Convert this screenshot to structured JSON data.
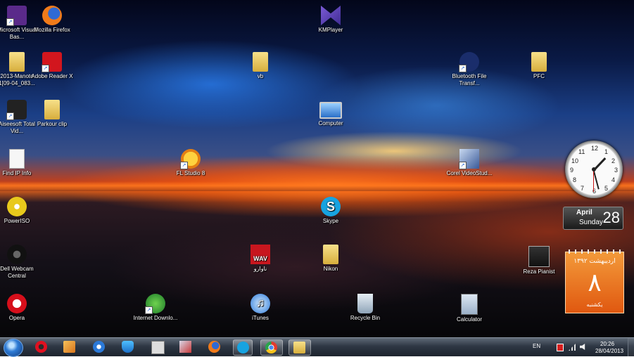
{
  "desktop_icons": [
    {
      "name": "Microsoft Visual Bas...",
      "key": "vb"
    },
    {
      "name": "Mozilla Firefox",
      "key": "firefox"
    },
    {
      "name": "2013-Manoto 1[09-04_083...",
      "key": "folder"
    },
    {
      "name": "Adobe Reader X",
      "key": "pdf"
    },
    {
      "name": "Aiseesoft Total Vid...",
      "key": "aise"
    },
    {
      "name": "Parkour clip",
      "key": "folder"
    },
    {
      "name": "Find IP Info",
      "key": "doc"
    },
    {
      "name": "PowerISO",
      "key": "disc"
    },
    {
      "name": "Dell Webcam Central",
      "key": "webcam"
    },
    {
      "name": "Opera",
      "key": "opera"
    },
    {
      "name": "KMPlayer",
      "key": "km"
    },
    {
      "name": "vb",
      "key": "folder"
    },
    {
      "name": "Bluetooth File Transf...",
      "key": "bt"
    },
    {
      "name": "PFC",
      "key": "folder"
    },
    {
      "name": "Computer",
      "key": "pc"
    },
    {
      "name": "FL Studio 8",
      "key": "fl"
    },
    {
      "name": "Corel VideoStud...",
      "key": "corel"
    },
    {
      "name": "Skype",
      "key": "skype"
    },
    {
      "name": "ناوارو",
      "key": "wav"
    },
    {
      "name": "Nikon",
      "key": "folder"
    },
    {
      "name": "Reza Pianist",
      "key": "reza"
    },
    {
      "name": "Internet Downlo...",
      "key": "idm"
    },
    {
      "name": "iTunes",
      "key": "itunes"
    },
    {
      "name": "Recycle Bin",
      "key": "bin"
    },
    {
      "name": "Calculator",
      "key": "calc"
    }
  ],
  "wav_text": "WAV",
  "skype_glyph": "S",
  "itunes_glyph": "♫",
  "clock": {
    "hour": 1,
    "minute": 27,
    "second": 30,
    "numbers": [
      "12",
      "1",
      "2",
      "3",
      "4",
      "5",
      "6",
      "7",
      "8",
      "9",
      "10",
      "11"
    ]
  },
  "date_gadget": {
    "month": "April",
    "weekday": "Sunday",
    "day": "28"
  },
  "calendar_gadget": {
    "month_year": "اردیبهشت ۱۳۹۲",
    "day": "۸",
    "weekday": "یکشنبه"
  },
  "taskbar": {
    "pinned": [
      "opera",
      "media-player",
      "internet-explorer",
      "security",
      "kmplayer",
      "cyberlink",
      "firefox",
      "skype",
      "chrome",
      "explorer"
    ],
    "active": [
      "skype",
      "chrome",
      "explorer"
    ],
    "language": "EN",
    "time": "20:26",
    "date": "28/04/2013"
  },
  "colors": {
    "calendar_orange": "#e86a18",
    "taskbar": "#2e3744"
  }
}
